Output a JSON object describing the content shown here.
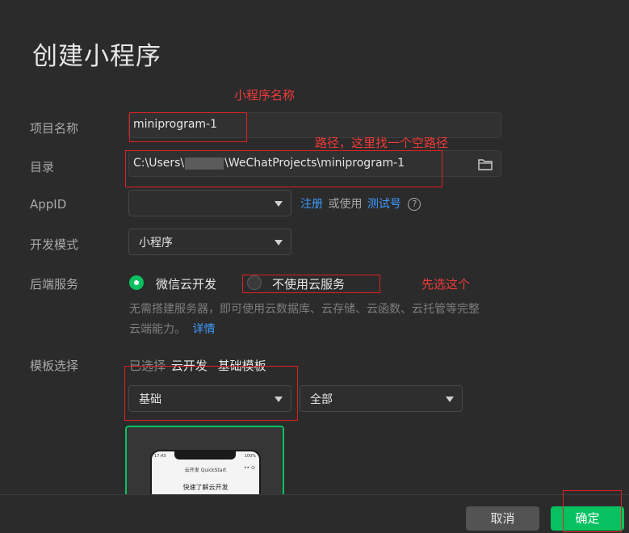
{
  "page": {
    "title": "创建小程序"
  },
  "form": {
    "name_label": "项目名称",
    "name_value": "miniprogram-1",
    "dir_label": "目录",
    "dir_prefix": "C:\\Users\\",
    "dir_suffix": "\\WeChatProjects\\miniprogram-1",
    "appid_label": "AppID",
    "appid_value": "",
    "register_link": "注册",
    "or_use_text": "或使用",
    "test_account_link": "测试号",
    "devmode_label": "开发模式",
    "devmode_value": "小程序",
    "backend_label": "后端服务",
    "backend_option_cloud": "微信云开发",
    "backend_option_none": "不使用云服务",
    "backend_selected": "微信云开发",
    "backend_desc": "无需搭建服务器，即可使用云数据库、云存储、云函数、云托管等完整",
    "backend_desc2": "云端能力。",
    "details_link": "详情",
    "template_label": "模板选择",
    "template_selected_prefix": "已选择",
    "template_selected_cat": "云开发",
    "template_selected_name": "基础模板",
    "template_category_value": "基础",
    "template_filter_value": "全部"
  },
  "template_card": {
    "phone_time": "17:43",
    "phone_battery": "100%",
    "phone_app_title": "云开发 QuickStart",
    "phone_heading": "快速了解云开发"
  },
  "annotations": {
    "name": "小程序名称",
    "path": "路径，这里找一个空路径",
    "choose": "先选这个"
  },
  "footer": {
    "cancel": "取消",
    "confirm": "确定"
  },
  "colors": {
    "accent_green": "#07c160",
    "link_blue": "#3d9bff",
    "annotation_red": "#f03a3a"
  }
}
